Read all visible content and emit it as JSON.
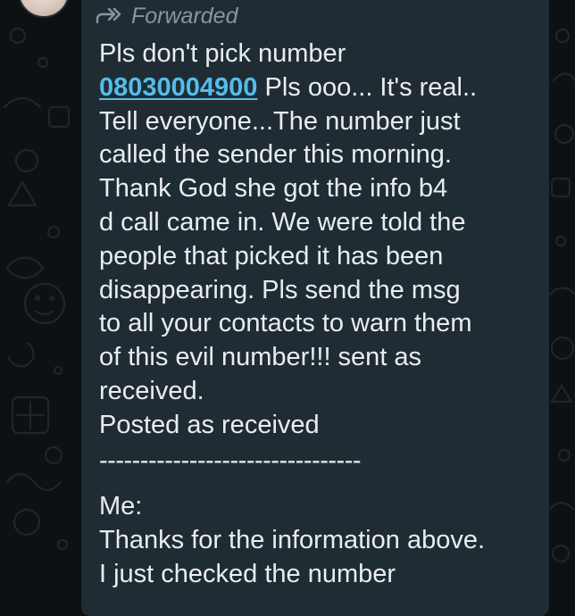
{
  "chat": {
    "forwarded_label": "Forwarded",
    "icons": {
      "forwarded": "forwarded-arrows-icon"
    },
    "colors": {
      "bubble": "#202c33",
      "background": "#0c1114",
      "text": "#e9edef",
      "meta": "#8696a0",
      "link": "#53bdeb"
    },
    "message": {
      "line1": "Pls don't pick number",
      "phone_number": "08030004900",
      "line2_rest": " Pls ooo... It's real..",
      "line3": "Tell everyone...The number just",
      "line4": "called the sender this morning.",
      "line5": "Thank God she got the info b4",
      "line6": "d call came in. We were told the",
      "line7": "people that picked it has been",
      "line8": "disappearing. Pls send the msg",
      "line9": "to all your contacts to warn them",
      "line10": "of this evil number!!! sent as",
      "line11": "received.",
      "line12": "Posted as received",
      "divider": "--------------------------------",
      "line13": "Me:",
      "line14": "Thanks for the information above.",
      "line15_partial": "I just checked the number"
    }
  }
}
